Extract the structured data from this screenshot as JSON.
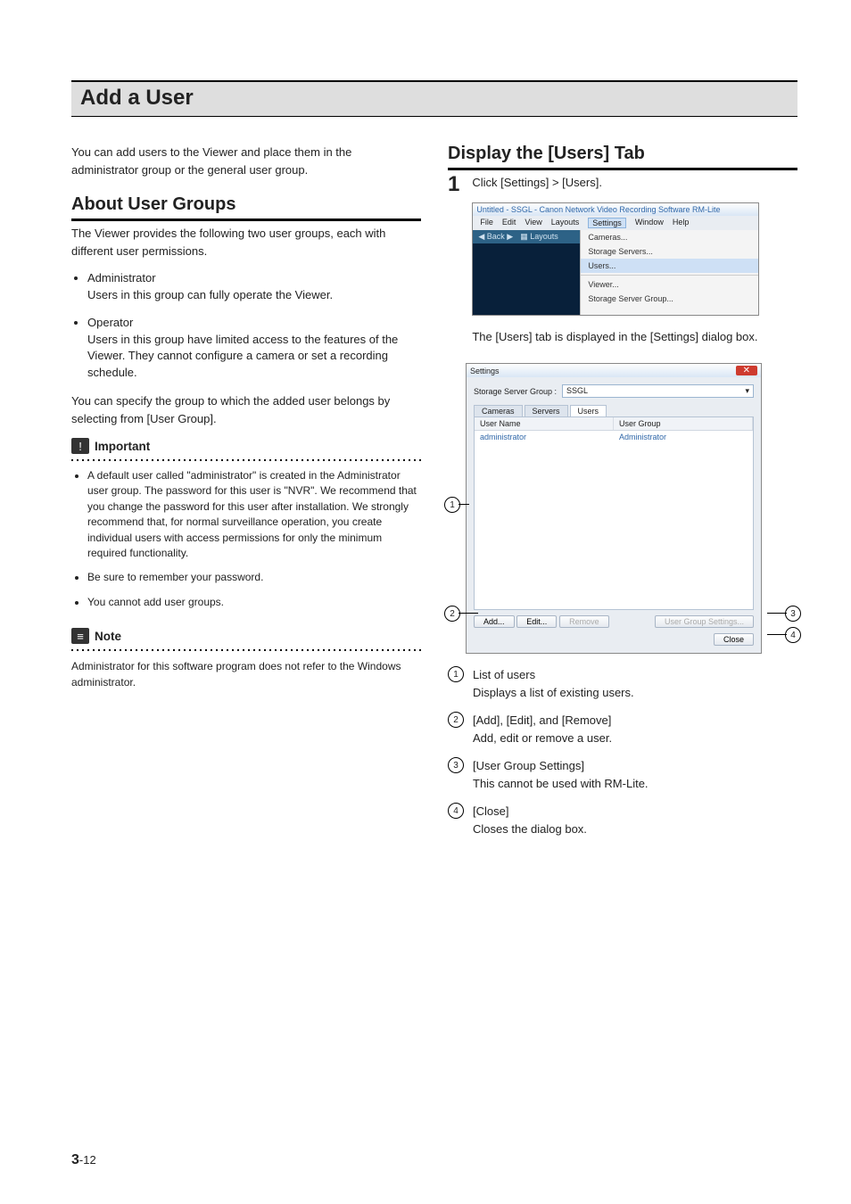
{
  "page": {
    "title": "Add a User",
    "intro": "You can add users to the Viewer and place them in the administrator group or the general user group.",
    "footer_chapter": "3",
    "footer_page": "-12"
  },
  "left": {
    "heading": "About User Groups",
    "p1": "The Viewer provides the following two user groups, each with different user permissions.",
    "groups": [
      {
        "name": "Administrator",
        "desc": "Users in this group can fully operate the Viewer."
      },
      {
        "name": "Operator",
        "desc": "Users in this group have limited access to the features of the Viewer. They cannot configure a camera or set a recording schedule."
      }
    ],
    "p2": "You can specify the group to which the added user belongs by selecting from [User Group].",
    "important_label": "Important",
    "important": [
      "A default user called \"administrator\" is created in the Administrator user group. The password for this user is \"NVR\". We recommend that you change the password for this user after installation. We strongly recommend that, for normal surveillance operation, you create individual users with access permissions for only the minimum required functionality.",
      "Be sure to remember your password.",
      "You cannot add user groups."
    ],
    "note_label": "Note",
    "note_text": "Administrator for this software program does not refer to the Windows administrator."
  },
  "right": {
    "heading": "Display the [Users] Tab",
    "step_num": "1",
    "step_text": "Click [Settings] > [Users].",
    "shot1": {
      "title": "Untitled - SSGL - Canon Network Video Recording Software RM-Lite",
      "menu": [
        "File",
        "Edit",
        "View",
        "Layouts",
        "Settings",
        "Window",
        "Help"
      ],
      "toolbar_back": "Back",
      "toolbar_layouts": "Layouts",
      "dropdown": [
        "Cameras...",
        "Storage Servers...",
        "Users...",
        "Viewer...",
        "Storage Server Group..."
      ],
      "highlight_index": 2
    },
    "result_text": "The [Users] tab is displayed in the [Settings] dialog box.",
    "shot2": {
      "win_title": "Settings",
      "group_label": "Storage Server Group :",
      "group_value": "SSGL",
      "tabs": [
        "Cameras",
        "Servers",
        "Users"
      ],
      "active_tab": 2,
      "cols": [
        "User Name",
        "User Group"
      ],
      "row": [
        "administrator",
        "Administrator"
      ],
      "buttons_left": [
        "Add...",
        "Edit...",
        "Remove"
      ],
      "buttons_right": "User Group Settings...",
      "close_btn": "Close"
    },
    "callouts": [
      "1",
      "2",
      "3",
      "4"
    ],
    "items": [
      {
        "title": "List of users",
        "desc": "Displays a list of existing users."
      },
      {
        "title": "[Add], [Edit], and [Remove]",
        "desc": "Add, edit or remove a user."
      },
      {
        "title": "[User Group Settings]",
        "desc": "This cannot be used with RM-Lite."
      },
      {
        "title": "[Close]",
        "desc": "Closes the dialog box."
      }
    ]
  }
}
